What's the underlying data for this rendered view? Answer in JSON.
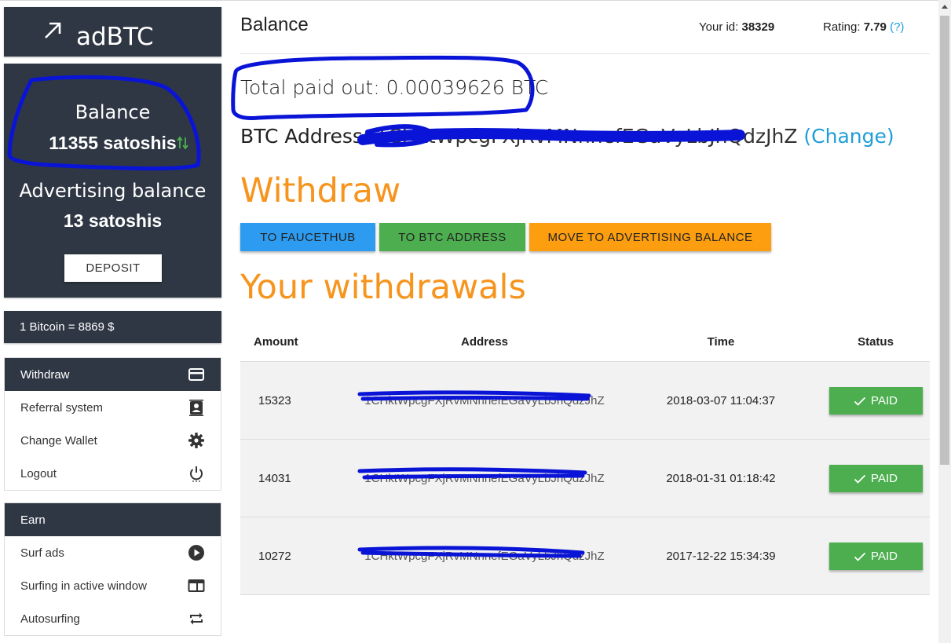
{
  "logo": {
    "brand": "adBTC",
    "icon": "trending-arrow-icon"
  },
  "balance": {
    "label": "Balance",
    "value": "11355 satoshis",
    "adv_label": "Advertising balance",
    "adv_value": "13 satoshis",
    "deposit_label": "DEPOSIT"
  },
  "rate": {
    "text": "1 Bitcoin = 8869 $"
  },
  "menu_main": [
    {
      "label": "Withdraw",
      "icon": "card-icon",
      "active": true
    },
    {
      "label": "Referral system",
      "icon": "contact-card-icon"
    },
    {
      "label": "Change Wallet",
      "icon": "gear-icon"
    },
    {
      "label": "Logout",
      "icon": "power-icon"
    }
  ],
  "menu_earn": {
    "header": "Earn",
    "items": [
      {
        "label": "Surf ads",
        "icon": "play-circle-icon"
      },
      {
        "label": "Surfing in active window",
        "icon": "window-icon"
      },
      {
        "label": "Autosurfing",
        "icon": "repeat-icon"
      }
    ]
  },
  "header": {
    "title": "Balance",
    "id_label": "Your id:",
    "id_value": "38329",
    "rating_label": "Rating:",
    "rating_value": "7.79",
    "rating_help": "(?)"
  },
  "paid_out": "Total paid out: 0.00039626 BTC",
  "address": {
    "label": "BTC Address:",
    "value": "1CHktWpcgFXjRvMNnnefEGaVyLbJhQdzJhZ",
    "change": "(Change)"
  },
  "withdraw": {
    "heading": "Withdraw",
    "btn_faucethub": "TO FAUCETHUB",
    "btn_btc": "TO BTC ADDRESS",
    "btn_adv": "MOVE TO ADVERTISING BALANCE"
  },
  "withdrawals": {
    "heading": "Your withdrawals",
    "columns": [
      "Amount",
      "Address",
      "Time",
      "Status"
    ],
    "rows": [
      {
        "amount": "15323",
        "address": "1CHktWpcgFXjRvMNnnefEGaVyLbJhQdzJhZ",
        "time": "2018-03-07 11:04:37",
        "status": "PAID"
      },
      {
        "amount": "14031",
        "address": "1CHktWpcgFXjRvMNnnefEGaVyLbJhQdzJhZ",
        "time": "2018-01-31 01:18:42",
        "status": "PAID"
      },
      {
        "amount": "10272",
        "address": "1CHktWpcgFXjRvMNnnefEGaVyLbJhQdzJhZ",
        "time": "2017-12-22 15:34:39",
        "status": "PAID"
      }
    ]
  },
  "colors": {
    "sidebar": "#2f3744",
    "accent_orange": "#f7941d",
    "link_blue": "#1e9ed8",
    "paid_green": "#4cae4f",
    "marker_blue": "#0a14d6"
  }
}
